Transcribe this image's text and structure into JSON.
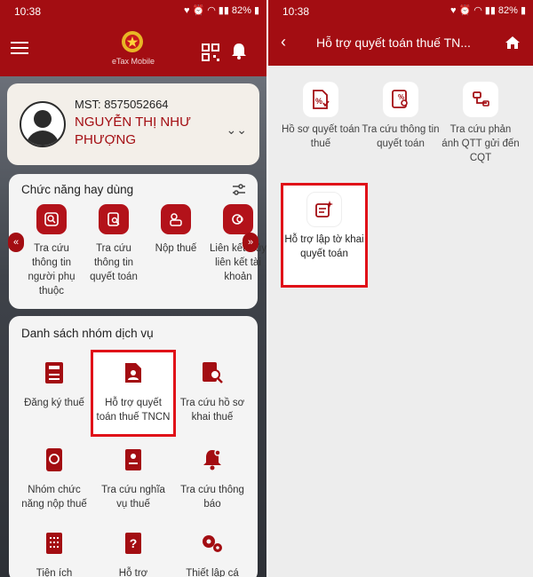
{
  "colors": {
    "brand": "#a30d12",
    "highlight": "#e01018",
    "panel": "#f4f4f4"
  },
  "status": {
    "time": "10:38",
    "battery": "82%"
  },
  "left": {
    "app_name": "eTax Mobile",
    "profile": {
      "mst": "MST: 8575052664",
      "name": "NGUYỄN THỊ NHƯ PHƯỢNG"
    },
    "favorites": {
      "title": "Chức năng hay dùng",
      "items": [
        {
          "label": "Tra cứu thông tin người phụ thuộc",
          "icon": "person-search-icon"
        },
        {
          "label": "Tra cứu thông tin quyết toán",
          "icon": "document-search-icon"
        },
        {
          "label": "Nộp thuế",
          "icon": "payment-icon"
        },
        {
          "label": "Liên kết Hủy liên kết tài khoản",
          "icon": "link-icon"
        }
      ]
    },
    "services": {
      "title": "Danh sách nhóm dịch vụ",
      "items": [
        {
          "label": "Đăng ký thuế",
          "icon": "calculator-icon"
        },
        {
          "label": "Hỗ trợ quyết toán thuế TNCN",
          "icon": "person-document-icon"
        },
        {
          "label": "Tra cứu hồ sơ khai thuế",
          "icon": "file-search-icon"
        },
        {
          "label": "Nhóm chức năng nộp thuế",
          "icon": "phone-payment-icon"
        },
        {
          "label": "Tra cứu nghĩa vụ thuế",
          "icon": "id-document-icon"
        },
        {
          "label": "Tra cứu thông báo",
          "icon": "bell-icon"
        },
        {
          "label": "Tiện ích",
          "icon": "keypad-icon"
        },
        {
          "label": "Hỗ trợ",
          "icon": "question-book-icon"
        },
        {
          "label": "Thiết lập cá",
          "icon": "gears-icon"
        }
      ]
    }
  },
  "right": {
    "title": "Hỗ trợ quyết toán thuế TN...",
    "items": [
      {
        "label": "Hồ sơ quyết toán thuế",
        "icon": "tax-file-icon"
      },
      {
        "label": "Tra cứu thông tin quyết toán",
        "icon": "settlement-search-icon"
      },
      {
        "label": "Tra cứu phản ánh QTT gửi đến CQT",
        "icon": "feedback-icon"
      },
      {
        "label": "Hỗ trợ lập tờ khai quyết toán",
        "icon": "form-sparkle-icon"
      }
    ]
  }
}
